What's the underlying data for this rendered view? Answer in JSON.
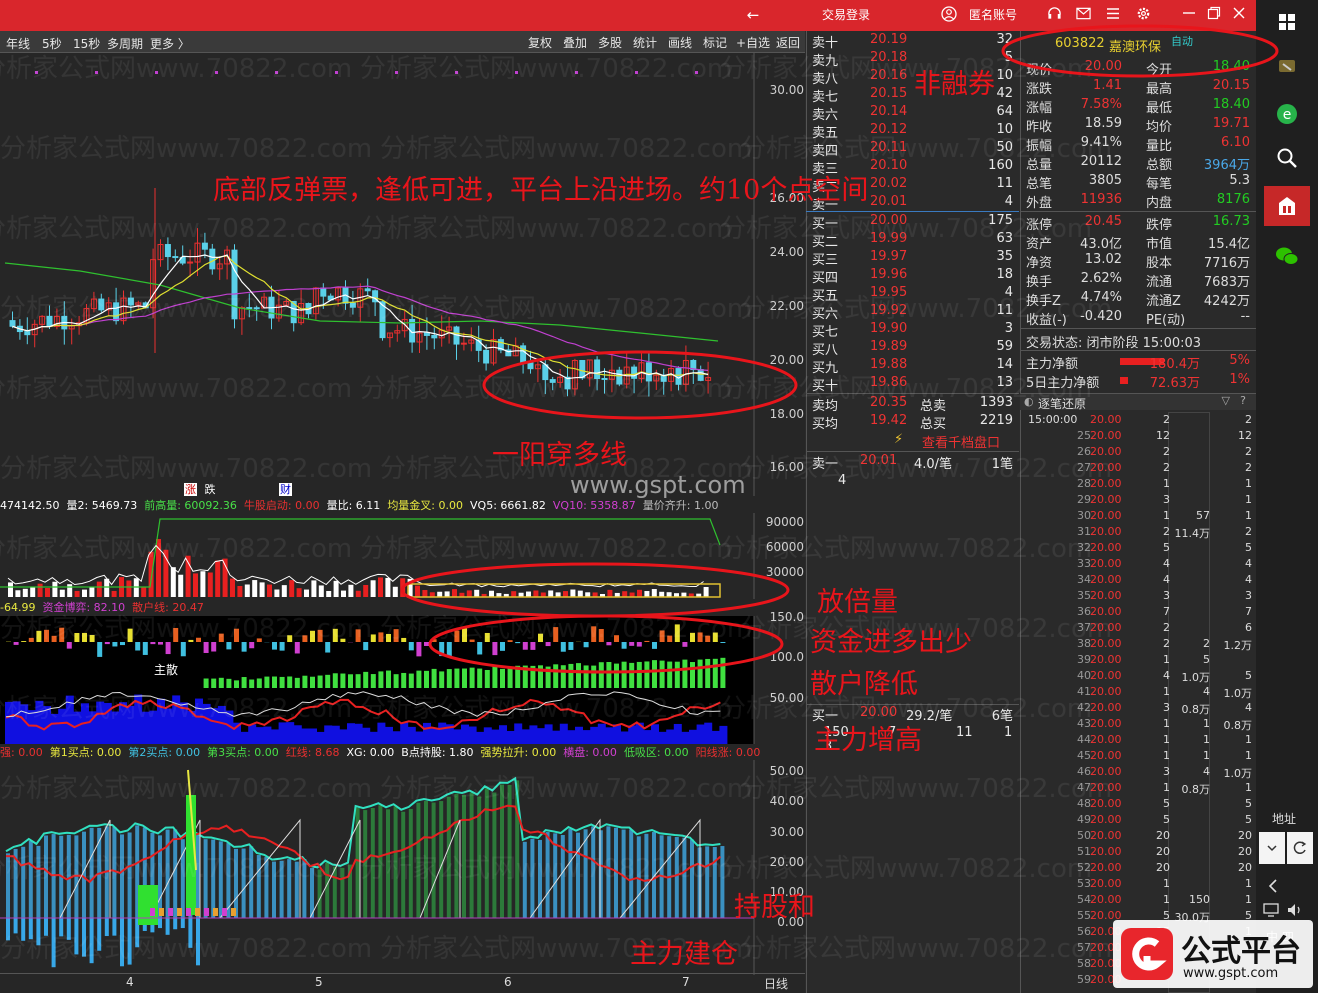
{
  "titlebar": {
    "back_icon": "←",
    "login": "交易登录",
    "user_icon": "user-icon",
    "account": "匿名账号",
    "icons": [
      "headset-icon",
      "mail-icon",
      "list-icon",
      "gear-icon"
    ]
  },
  "toolbar": {
    "left": [
      "年线",
      "5秒",
      "15秒",
      "多周期",
      "更多 〉"
    ],
    "right": [
      "复权",
      "叠加",
      "多股",
      "统计",
      "画线",
      "标记",
      "+自选",
      "返回"
    ]
  },
  "chart": {
    "main_yaxis": [
      "30.00",
      "26.00",
      "24.00",
      "22.00",
      "20.00",
      "18.00",
      "16.00"
    ],
    "badges": [
      "涨",
      "跌",
      "财"
    ],
    "vol_head": [
      {
        "t": "474142.50",
        "c": "#ffffff"
      },
      {
        "t": "量2: 5469.73",
        "c": "#ffffff"
      },
      {
        "t": "前高量: 60092.36",
        "c": "#48e048"
      },
      {
        "t": "牛股启动: 0.00",
        "c": "#e83030"
      },
      {
        "t": "量比: 6.11",
        "c": "#ffffff"
      },
      {
        "t": "均量金叉: 0.00",
        "c": "#e8e840"
      },
      {
        "t": "VQ5: 6661.82",
        "c": "#ffffff"
      },
      {
        "t": "VQ10: 5358.87",
        "c": "#d040d0"
      },
      {
        "t": "量价齐升: 1.00",
        "c": "#bbbbbb"
      }
    ],
    "vol_yaxis": [
      "90000",
      "60000",
      "30000"
    ],
    "fund_head": [
      {
        "t": "-64.99",
        "c": "#e8e840"
      },
      {
        "t": "资金博弈: 82.10",
        "c": "#d040d0"
      },
      {
        "t": "散户线: 20.47",
        "c": "#e83030"
      }
    ],
    "fund_yaxis": [
      "150.0",
      "100.0",
      "50.00"
    ],
    "fund_label": "主散",
    "hold_head": [
      {
        "t": "强: 0.00",
        "c": "#e83030"
      },
      {
        "t": "第1买点: 0.00",
        "c": "#e8e840"
      },
      {
        "t": "第2买点: 0.00",
        "c": "#40c0e0"
      },
      {
        "t": "第3买点: 0.00",
        "c": "#48e048"
      },
      {
        "t": "红线: 8.68",
        "c": "#e83030"
      },
      {
        "t": "XG: 0.00",
        "c": "#ffffff"
      },
      {
        "t": "B点持股: 1.80",
        "c": "#ffffff"
      },
      {
        "t": "强势拉升: 0.00",
        "c": "#e8e840"
      },
      {
        "t": "横盘: 0.00",
        "c": "#d040d0"
      },
      {
        "t": "低吸区: 0.00",
        "c": "#48e048"
      },
      {
        "t": "阳线涨: 0.00",
        "c": "#e83030"
      }
    ],
    "hold_yaxis": [
      "50.00",
      "40.00",
      "30.00",
      "20.00",
      "10.00",
      "0.00"
    ],
    "xaxis": [
      "4",
      "5",
      "6",
      "7"
    ],
    "period": "日线"
  },
  "orderbook": {
    "asks": [
      {
        "l": "卖十",
        "p": "20.19",
        "v": "32"
      },
      {
        "l": "卖九",
        "p": "20.18",
        "v": "5"
      },
      {
        "l": "卖八",
        "p": "20.16",
        "v": "10"
      },
      {
        "l": "卖七",
        "p": "20.15",
        "v": "42"
      },
      {
        "l": "卖六",
        "p": "20.14",
        "v": "64"
      },
      {
        "l": "卖五",
        "p": "20.12",
        "v": "10"
      },
      {
        "l": "卖四",
        "p": "20.11",
        "v": "50"
      },
      {
        "l": "卖三",
        "p": "20.10",
        "v": "160"
      },
      {
        "l": "卖二",
        "p": "20.02",
        "v": "11"
      },
      {
        "l": "卖一",
        "p": "20.01",
        "v": "4"
      }
    ],
    "bids": [
      {
        "l": "买一",
        "p": "20.00",
        "v": "175"
      },
      {
        "l": "买二",
        "p": "19.99",
        "v": "63"
      },
      {
        "l": "买三",
        "p": "19.97",
        "v": "35"
      },
      {
        "l": "买四",
        "p": "19.96",
        "v": "18"
      },
      {
        "l": "买五",
        "p": "19.95",
        "v": "4"
      },
      {
        "l": "买六",
        "p": "19.92",
        "v": "11"
      },
      {
        "l": "买七",
        "p": "19.90",
        "v": "3"
      },
      {
        "l": "买八",
        "p": "19.89",
        "v": "59"
      },
      {
        "l": "买九",
        "p": "19.88",
        "v": "14"
      },
      {
        "l": "买十",
        "p": "19.86",
        "v": "13"
      }
    ],
    "avg_sell_label": "卖均",
    "avg_sell": "20.35",
    "total_sell_label": "总卖",
    "total_sell": "1393",
    "avg_buy_label": "买均",
    "avg_buy": "19.42",
    "total_buy_label": "总买",
    "total_buy": "2219",
    "thousand_link": "查看千档盘口",
    "sell1": {
      "l": "卖一",
      "p": "20.01",
      "per": "4.0/笔",
      "n": "1笔",
      "q": "4"
    },
    "buy1": {
      "l": "买一",
      "p": "20.00",
      "per": "29.2/笔",
      "n": "6笔",
      "q": [
        "150",
        "3",
        "7",
        "11",
        "1"
      ]
    }
  },
  "quote": {
    "code": "603822",
    "name": "嘉澳环保",
    "auto": "自动",
    "rows": [
      [
        {
          "t": "现价",
          "c": "#ddd"
        },
        {
          "t": "20.00",
          "c": "#e33"
        },
        {
          "t": "今开",
          "c": "#ddd"
        },
        {
          "t": "18.40",
          "c": "#2c2"
        }
      ],
      [
        {
          "t": "涨跌",
          "c": "#ddd"
        },
        {
          "t": "1.41",
          "c": "#e33"
        },
        {
          "t": "最高",
          "c": "#ddd"
        },
        {
          "t": "20.15",
          "c": "#e33"
        }
      ],
      [
        {
          "t": "涨幅",
          "c": "#ddd"
        },
        {
          "t": "7.58%",
          "c": "#e33"
        },
        {
          "t": "最低",
          "c": "#ddd"
        },
        {
          "t": "18.40",
          "c": "#2c2"
        }
      ],
      [
        {
          "t": "昨收",
          "c": "#ddd"
        },
        {
          "t": "18.59",
          "c": "#ddd"
        },
        {
          "t": "均价",
          "c": "#ddd"
        },
        {
          "t": "19.71",
          "c": "#e33"
        }
      ],
      [
        {
          "t": "振幅",
          "c": "#ddd"
        },
        {
          "t": "9.41%",
          "c": "#ddd"
        },
        {
          "t": "量比",
          "c": "#ddd"
        },
        {
          "t": "6.10",
          "c": "#e33"
        }
      ],
      [
        {
          "t": "总量",
          "c": "#ddd"
        },
        {
          "t": "20112",
          "c": "#ddd"
        },
        {
          "t": "总额",
          "c": "#ddd"
        },
        {
          "t": "3964万",
          "c": "#4aa8e8"
        }
      ],
      [
        {
          "t": "总笔",
          "c": "#ddd"
        },
        {
          "t": "3805",
          "c": "#ddd"
        },
        {
          "t": "每笔",
          "c": "#ddd"
        },
        {
          "t": "5.3",
          "c": "#ddd"
        }
      ],
      [
        {
          "t": "外盘",
          "c": "#ddd"
        },
        {
          "t": "11936",
          "c": "#e33"
        },
        {
          "t": "内盘",
          "c": "#ddd"
        },
        {
          "t": "8176",
          "c": "#2c2"
        }
      ],
      [
        {
          "t": "涨停",
          "c": "#ddd"
        },
        {
          "t": "20.45",
          "c": "#e33"
        },
        {
          "t": "跌停",
          "c": "#ddd"
        },
        {
          "t": "16.73",
          "c": "#2c2"
        }
      ],
      [
        {
          "t": "资产",
          "c": "#ddd"
        },
        {
          "t": "43.0亿",
          "c": "#ddd"
        },
        {
          "t": "市值",
          "c": "#ddd"
        },
        {
          "t": "15.4亿",
          "c": "#ddd"
        }
      ],
      [
        {
          "t": "净资",
          "c": "#ddd"
        },
        {
          "t": "13.02",
          "c": "#ddd"
        },
        {
          "t": "股本",
          "c": "#ddd"
        },
        {
          "t": "7716万",
          "c": "#ddd"
        }
      ],
      [
        {
          "t": "换手",
          "c": "#ddd"
        },
        {
          "t": "2.62%",
          "c": "#ddd"
        },
        {
          "t": "流通",
          "c": "#ddd"
        },
        {
          "t": "7683万",
          "c": "#ddd"
        }
      ],
      [
        {
          "t": "换手Z",
          "c": "#ddd"
        },
        {
          "t": "4.74%",
          "c": "#ddd"
        },
        {
          "t": "流通Z",
          "c": "#ddd"
        },
        {
          "t": "4242万",
          "c": "#ddd"
        }
      ],
      [
        {
          "t": "收益(-)",
          "c": "#ddd"
        },
        {
          "t": "-0.420",
          "c": "#ddd"
        },
        {
          "t": "PE(动)",
          "c": "#ddd"
        },
        {
          "t": "--",
          "c": "#ddd"
        }
      ]
    ],
    "status_label": "交易状态: 闭市阶段 15:00:03",
    "net_main_label": "主力净额",
    "net_main": "180.4万",
    "net_main_pct": "5%",
    "net5_label": "5日主力净额",
    "net5": "72.63万",
    "net5_pct": "1%",
    "ticks_title": "逐笔还原",
    "ticks_first_time": "15:00:00"
  },
  "ticks": [
    {
      "n": "",
      "p": "20.00",
      "v": "2",
      "m": "",
      "r": "2"
    },
    {
      "n": "25",
      "p": "20.00",
      "v": "12",
      "m": "",
      "r": "12"
    },
    {
      "n": "26",
      "p": "20.00",
      "v": "2",
      "m": "",
      "r": "2"
    },
    {
      "n": "27",
      "p": "20.00",
      "v": "2",
      "m": "",
      "r": "2"
    },
    {
      "n": "28",
      "p": "20.00",
      "v": "1",
      "m": "",
      "r": "1"
    },
    {
      "n": "29",
      "p": "20.00",
      "v": "3",
      "m": "",
      "r": "1"
    },
    {
      "n": "30",
      "p": "20.00",
      "v": "1",
      "m": "57",
      "r": "1"
    },
    {
      "n": "31",
      "p": "20.00",
      "v": "2",
      "m": "11.4万",
      "r": "2"
    },
    {
      "n": "32",
      "p": "20.00",
      "v": "5",
      "m": "",
      "r": "5"
    },
    {
      "n": "33",
      "p": "20.00",
      "v": "4",
      "m": "",
      "r": "4"
    },
    {
      "n": "34",
      "p": "20.00",
      "v": "4",
      "m": "",
      "r": "4"
    },
    {
      "n": "35",
      "p": "20.00",
      "v": "3",
      "m": "",
      "r": "3"
    },
    {
      "n": "36",
      "p": "20.00",
      "v": "7",
      "m": "",
      "r": "7"
    },
    {
      "n": "37",
      "p": "20.00",
      "v": "2",
      "m": "",
      "r": "6"
    },
    {
      "n": "38",
      "p": "20.00",
      "v": "2",
      "m": "2",
      "r": "1.2万"
    },
    {
      "n": "39",
      "p": "20.00",
      "v": "1",
      "m": "5",
      "r": ""
    },
    {
      "n": "40",
      "p": "20.00",
      "v": "4",
      "m": "1.0万",
      "r": "5"
    },
    {
      "n": "41",
      "p": "20.00",
      "v": "1",
      "m": "4",
      "r": "1.0万"
    },
    {
      "n": "42",
      "p": "20.00",
      "v": "3",
      "m": "0.8万",
      "r": "4"
    },
    {
      "n": "43",
      "p": "20.00",
      "v": "1",
      "m": "1",
      "r": "0.8万"
    },
    {
      "n": "44",
      "p": "20.00",
      "v": "1",
      "m": "1",
      "r": "1"
    },
    {
      "n": "45",
      "p": "20.00",
      "v": "1",
      "m": "1",
      "r": "1"
    },
    {
      "n": "46",
      "p": "20.00",
      "v": "3",
      "m": "4",
      "r": "1.0万"
    },
    {
      "n": "47",
      "p": "20.00",
      "v": "1",
      "m": "0.8万",
      "r": "1"
    },
    {
      "n": "48",
      "p": "20.00",
      "v": "5",
      "m": "",
      "r": "5"
    },
    {
      "n": "49",
      "p": "20.00",
      "v": "5",
      "m": "",
      "r": "5"
    },
    {
      "n": "50",
      "p": "20.00",
      "v": "20",
      "m": "",
      "r": "20"
    },
    {
      "n": "51",
      "p": "20.00",
      "v": "20",
      "m": "",
      "r": "20"
    },
    {
      "n": "52",
      "p": "20.00",
      "v": "20",
      "m": "",
      "r": "20"
    },
    {
      "n": "53",
      "p": "20.00",
      "v": "1",
      "m": "",
      "r": "1"
    },
    {
      "n": "54",
      "p": "20.00",
      "v": "1",
      "m": "150",
      "r": "1"
    },
    {
      "n": "55",
      "p": "20.00",
      "v": "5",
      "m": "30.0万",
      "r": "5"
    },
    {
      "n": "56",
      "p": "20.00",
      "v": "15",
      "m": "",
      "r": "1"
    },
    {
      "n": "57",
      "p": "20.00",
      "v": "",
      "m": "",
      "r": ""
    },
    {
      "n": "58",
      "p": "20.00",
      "v": "",
      "m": "",
      "r": ""
    },
    {
      "n": "59",
      "p": "20.00",
      "v": "",
      "m": "",
      "r": ""
    }
  ],
  "annotations": {
    "non_margin": "非融券",
    "bottom_rebound": "底部反弹票，逢低可进，平台上沿进场。约10个点空间",
    "yang_cross": "一阳穿多线",
    "double_vol": "放倍量",
    "funds": "资金进多出少",
    "retail": "散户降低",
    "main_up": "主力增高",
    "hold1": "持股和",
    "hold2": "主力建仓"
  },
  "watermarks": {
    "wm1": "分析家公式网www.70822.com",
    "gspt": "www.gspt.com"
  },
  "logo": {
    "name": "公式平台",
    "url": "www.gspt.com"
  },
  "taskbar": {
    "address": "地址",
    "clock": "中 四"
  }
}
